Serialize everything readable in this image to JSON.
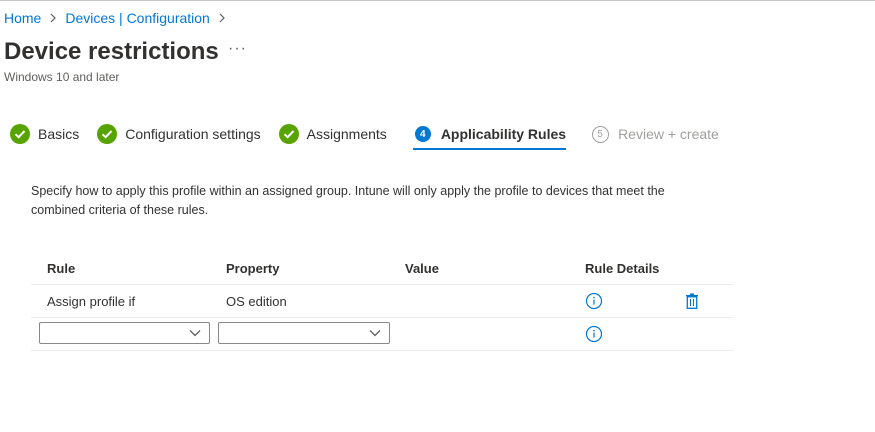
{
  "breadcrumb": {
    "items": [
      "Home",
      "Devices | Configuration"
    ]
  },
  "page": {
    "title": "Device restrictions",
    "more": "···",
    "subtitle": "Windows 10 and later"
  },
  "steps": [
    {
      "label": "Basics",
      "state": "complete"
    },
    {
      "label": "Configuration settings",
      "state": "complete"
    },
    {
      "label": "Assignments",
      "state": "complete"
    },
    {
      "label": "Applicability Rules",
      "state": "active",
      "number": "4"
    },
    {
      "label": "Review + create",
      "state": "disabled",
      "number": "5"
    }
  ],
  "description": "Specify how to apply this profile within an assigned group. Intune will only apply the profile to devices that meet the combined criteria of these rules.",
  "table": {
    "headers": [
      "Rule",
      "Property",
      "Value",
      "Rule Details"
    ],
    "rows": [
      {
        "rule": "Assign profile if",
        "property": "OS edition",
        "value": ""
      }
    ],
    "new_row": {
      "rule_value": "",
      "property_value": ""
    }
  },
  "colors": {
    "accent": "#0078d4",
    "success": "#57a300",
    "text": "#323130",
    "disabled": "#a19f9d"
  },
  "icons": {
    "complete": "checkmark-circle-icon",
    "info": "info-icon",
    "delete": "trash-icon",
    "dropdown": "chevron-down-icon"
  }
}
